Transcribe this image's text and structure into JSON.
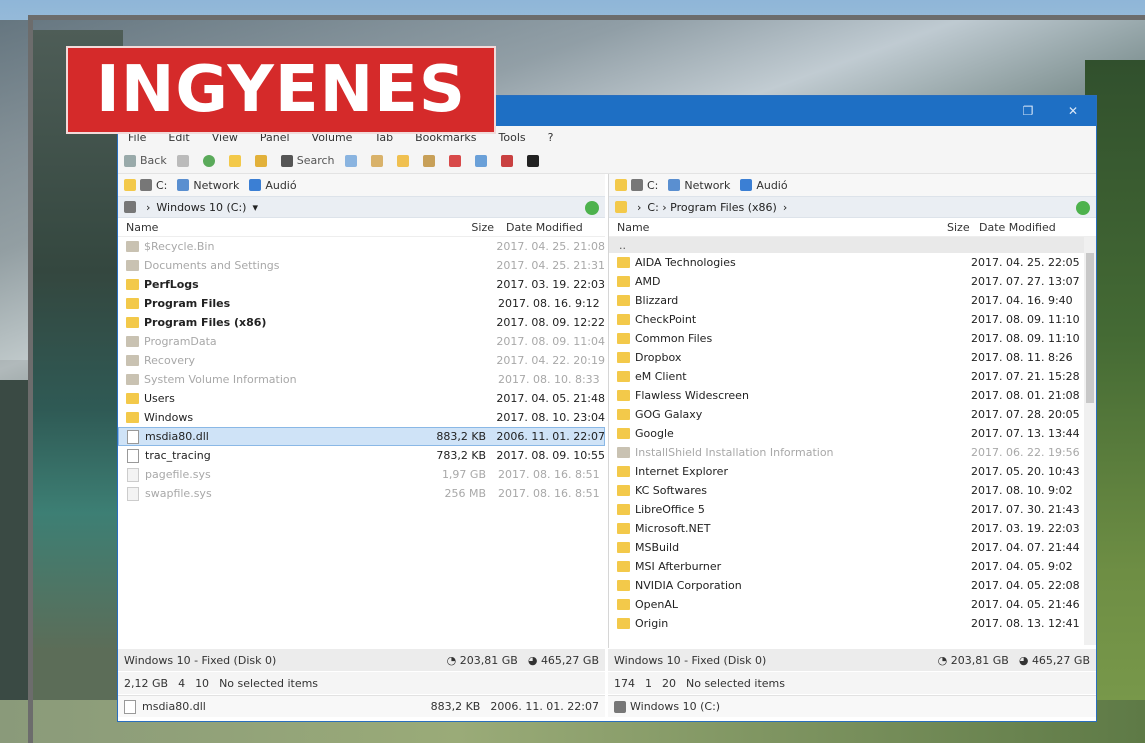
{
  "banner": {
    "text": "INGYENES"
  },
  "menu": [
    "File",
    "Edit",
    "View",
    "Panel",
    "Volume",
    "Tab",
    "Bookmarks",
    "Tools",
    "?"
  ],
  "toolbar": {
    "back": "Back",
    "search": "Search"
  },
  "left": {
    "drives": {
      "c": "C:",
      "network": "Network",
      "audio": "Audió"
    },
    "path": "Windows 10 (C:)",
    "headers": {
      "name": "Name",
      "size": "Size",
      "date": "Date Modified"
    },
    "rows": [
      {
        "name": "$Recycle.Bin",
        "size": "",
        "date": "2017. 04. 25. 21:08",
        "type": "folder",
        "dim": true,
        "bold": false,
        "sel": false
      },
      {
        "name": "Documents and Settings",
        "size": "",
        "date": "2017. 04. 25. 21:31",
        "type": "folder",
        "dim": true,
        "bold": false,
        "sel": false
      },
      {
        "name": "PerfLogs",
        "size": "",
        "date": "2017. 03. 19. 22:03",
        "type": "folder",
        "dim": false,
        "bold": true,
        "sel": false
      },
      {
        "name": "Program Files",
        "size": "",
        "date": "2017. 08. 16. 9:12",
        "type": "folder",
        "dim": false,
        "bold": true,
        "sel": false
      },
      {
        "name": "Program Files (x86)",
        "size": "",
        "date": "2017. 08. 09. 12:22",
        "type": "folder",
        "dim": false,
        "bold": true,
        "sel": false
      },
      {
        "name": "ProgramData",
        "size": "",
        "date": "2017. 08. 09. 11:04",
        "type": "folder",
        "dim": true,
        "bold": false,
        "sel": false
      },
      {
        "name": "Recovery",
        "size": "",
        "date": "2017. 04. 22. 20:19",
        "type": "folder",
        "dim": true,
        "bold": false,
        "sel": false
      },
      {
        "name": "System Volume Information",
        "size": "",
        "date": "2017. 08. 10. 8:33",
        "type": "folder",
        "dim": true,
        "bold": false,
        "sel": false
      },
      {
        "name": "Users",
        "size": "",
        "date": "2017. 04. 05. 21:48",
        "type": "folder",
        "dim": false,
        "bold": false,
        "sel": false
      },
      {
        "name": "Windows",
        "size": "",
        "date": "2017. 08. 10. 23:04",
        "type": "folder",
        "dim": false,
        "bold": false,
        "sel": false
      },
      {
        "name": "msdia80.dll",
        "size": "883,2 KB",
        "date": "2006. 11. 01. 22:07",
        "type": "file",
        "dim": false,
        "bold": false,
        "sel": true
      },
      {
        "name": "trac_tracing",
        "size": "783,2 KB",
        "date": "2017. 08. 09. 10:55",
        "type": "file",
        "dim": false,
        "bold": false,
        "sel": false
      },
      {
        "name": "pagefile.sys",
        "size": "1,97 GB",
        "date": "2017. 08. 16. 8:51",
        "type": "file",
        "dim": true,
        "bold": false,
        "sel": false
      },
      {
        "name": "swapfile.sys",
        "size": "256 MB",
        "date": "2017. 08. 16. 8:51",
        "type": "file",
        "dim": true,
        "bold": false,
        "sel": false
      }
    ],
    "status1": {
      "label": "Windows 10 - Fixed (Disk 0)",
      "free": "203,81 GB",
      "total": "465,27 GB"
    },
    "status2": {
      "size": "2,12 GB",
      "dirs": "4",
      "files": "10",
      "msg": "No selected items"
    },
    "status3": {
      "name": "msdia80.dll",
      "size": "883,2 KB",
      "date": "2006. 11. 01. 22:07"
    }
  },
  "right": {
    "drives": {
      "c": "C:",
      "network": "Network",
      "audio": "Audió"
    },
    "path": "C: › Program Files (x86)",
    "headers": {
      "name": "Name",
      "size": "Size",
      "date": "Date Modified"
    },
    "updir": "..",
    "rows": [
      {
        "name": "AIDA Technologies",
        "date": "2017. 04. 25. 22:05",
        "dim": false
      },
      {
        "name": "AMD",
        "date": "2017. 07. 27. 13:07",
        "dim": false
      },
      {
        "name": "Blizzard",
        "date": "2017. 04. 16. 9:40",
        "dim": false
      },
      {
        "name": "CheckPoint",
        "date": "2017. 08. 09. 11:10",
        "dim": false
      },
      {
        "name": "Common Files",
        "date": "2017. 08. 09. 11:10",
        "dim": false
      },
      {
        "name": "Dropbox",
        "date": "2017. 08. 11. 8:26",
        "dim": false
      },
      {
        "name": "eM Client",
        "date": "2017. 07. 21. 15:28",
        "dim": false
      },
      {
        "name": "Flawless Widescreen",
        "date": "2017. 08. 01. 21:08",
        "dim": false
      },
      {
        "name": "GOG Galaxy",
        "date": "2017. 07. 28. 20:05",
        "dim": false
      },
      {
        "name": "Google",
        "date": "2017. 07. 13. 13:44",
        "dim": false
      },
      {
        "name": "InstallShield Installation Information",
        "date": "2017. 06. 22. 19:56",
        "dim": true
      },
      {
        "name": "Internet Explorer",
        "date": "2017. 05. 20. 10:43",
        "dim": false
      },
      {
        "name": "KC Softwares",
        "date": "2017. 08. 10. 9:02",
        "dim": false
      },
      {
        "name": "LibreOffice 5",
        "date": "2017. 07. 30. 21:43",
        "dim": false
      },
      {
        "name": "Microsoft.NET",
        "date": "2017. 03. 19. 22:03",
        "dim": false
      },
      {
        "name": "MSBuild",
        "date": "2017. 04. 07. 21:44",
        "dim": false
      },
      {
        "name": "MSI Afterburner",
        "date": "2017. 04. 05. 9:02",
        "dim": false
      },
      {
        "name": "NVIDIA Corporation",
        "date": "2017. 04. 05. 22:08",
        "dim": false
      },
      {
        "name": "OpenAL",
        "date": "2017. 04. 05. 21:46",
        "dim": false
      },
      {
        "name": "Origin",
        "date": "2017. 08. 13. 12:41",
        "dim": false
      }
    ],
    "status1": {
      "label": "Windows 10 - Fixed (Disk 0)",
      "free": "203,81 GB",
      "total": "465,27 GB"
    },
    "status2": {
      "size": "174",
      "dirs": "1",
      "files": "20",
      "msg": "No selected items"
    },
    "status3": {
      "name": "Windows 10 (C:)"
    }
  },
  "colors": {
    "title": "#1e6fc4",
    "banner": "#d52a2a",
    "selection": "#cfe3f7",
    "folder": "#f3c94a"
  }
}
